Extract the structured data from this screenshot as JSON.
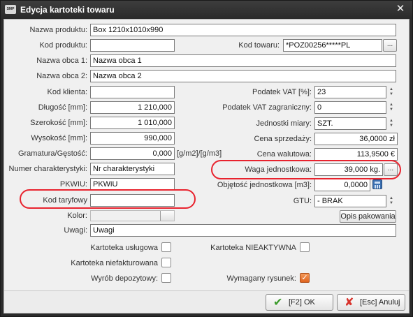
{
  "window": {
    "title": "Edycja kartoteki towaru",
    "app_icon_text": "SMP"
  },
  "fields": {
    "nazwa_produktu": {
      "label": "Nazwa produktu:",
      "value": "Box 1210x1010x990"
    },
    "kod_produktu": {
      "label": "Kod produktu:",
      "value": ""
    },
    "kod_towaru": {
      "label": "Kod towaru:",
      "value": "*POZ00256*****PL"
    },
    "nazwa_obca_1": {
      "label": "Nazwa obca 1:",
      "value": "Nazwa obca 1"
    },
    "nazwa_obca_2": {
      "label": "Nazwa obca 2:",
      "value": "Nazwa obca 2"
    },
    "kod_klienta": {
      "label": "Kod klienta:",
      "value": ""
    },
    "dlugosc": {
      "label": "Długość [mm]:",
      "value": "1 210,000"
    },
    "szerokosc": {
      "label": "Szerokość [mm]:",
      "value": "1 010,000"
    },
    "wysokosc": {
      "label": "Wysokość [mm]:",
      "value": "990,000"
    },
    "gramatura": {
      "label": "Gramatura/Gęstość:",
      "value": "0,000",
      "unit": "[g/m2]/[g/m3]"
    },
    "numer_charakterystyki": {
      "label": "Numer charakterystyki:",
      "value": "Nr charakterystyki"
    },
    "pkwiu": {
      "label": "PKWIU:",
      "value": "PKWiU"
    },
    "kod_taryfowy": {
      "label": "Kod taryfowy",
      "value": ""
    },
    "kolor": {
      "label": "Kolor:"
    },
    "uwagi": {
      "label": "Uwagi:",
      "value": "Uwagi"
    },
    "podatek_vat": {
      "label": "Podatek VAT [%]:",
      "value": "23"
    },
    "podatek_vat_zagr": {
      "label": "Podatek VAT zagraniczny:",
      "value": "0"
    },
    "jednostki_miary": {
      "label": "Jednostki miary:",
      "value": "SZT."
    },
    "cena_sprzedazy": {
      "label": "Cena sprzedaży:",
      "value": "36,0000 zł"
    },
    "cena_walutowa": {
      "label": "Cena walutowa:",
      "value": "113,9500 €"
    },
    "waga_jednostkowa": {
      "label": "Waga jednostkowa:",
      "value": "39,000 kg."
    },
    "objetosc": {
      "label": "Objętość jednostkowa [m3]:",
      "value": "0,0000"
    },
    "gtu": {
      "label": "GTU:",
      "value": "- BRAK"
    }
  },
  "buttons": {
    "ellipsis": "...",
    "opis_pakowania": "Opis pakowania",
    "ok": "[F2] OK",
    "cancel": "[Esc] Anuluj"
  },
  "checkboxes": {
    "kartoteka_uslugowa": {
      "label": "Kartoteka usługowa",
      "checked": false
    },
    "kartoteka_niefakturowana": {
      "label": "Kartoteka niefakturowana",
      "checked": false
    },
    "wyrob_depozytowy": {
      "label": "Wyrób depozytowy:",
      "checked": false
    },
    "kartoteka_nieaktywna": {
      "label": "Kartoteka NIEAKTYWNA",
      "checked": false
    },
    "wymagany_rysunek": {
      "label": "Wymagany rysunek:",
      "checked": true
    }
  },
  "colors": {
    "highlight_ring": "#e8232e",
    "checked": "#e0641e"
  }
}
